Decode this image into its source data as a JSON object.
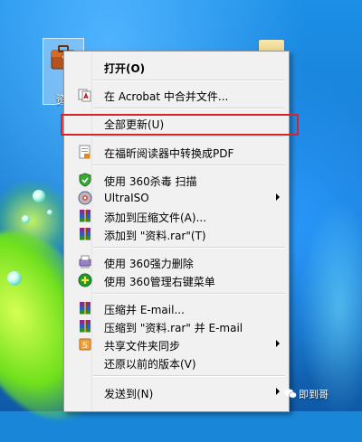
{
  "desktop": {
    "selected_icon_label": "资",
    "watermark_text": "即到哥"
  },
  "context_menu": {
    "items": [
      {
        "label": "打开(O)",
        "bold": true,
        "icon": "none"
      },
      {
        "label": "在 Acrobat 中合并文件...",
        "icon": "acrobat-icon"
      },
      {
        "label": "全部更新(U)",
        "icon": "none",
        "highlighted": true
      },
      {
        "label": "在福昕阅读器中转换成PDF",
        "icon": "foxit-pdf-icon"
      },
      {
        "label": "使用 360杀毒 扫描",
        "icon": "shield-360-icon"
      },
      {
        "label": "UltraISO",
        "icon": "ultraiso-icon",
        "submenu": true
      },
      {
        "label": "添加到压缩文件(A)...",
        "icon": "winrar-icon"
      },
      {
        "label": "添加到 \"资料.rar\"(T)",
        "icon": "winrar-icon"
      },
      {
        "label": "使用 360强力删除",
        "icon": "shredder-icon"
      },
      {
        "label": "使用 360管理右键菜单",
        "icon": "plus-360-icon"
      },
      {
        "label": "压缩并 E-mail...",
        "icon": "winrar-icon"
      },
      {
        "label": "压缩到 \"资料.rar\" 并 E-mail",
        "icon": "winrar-icon"
      },
      {
        "label": "共享文件夹同步",
        "icon": "share-sync-icon",
        "submenu": true
      },
      {
        "label": "还原以前的版本(V)",
        "icon": "none"
      },
      {
        "label": "发送到(N)",
        "icon": "none",
        "submenu": true
      }
    ]
  },
  "colors": {
    "highlight_border": "#d9232b",
    "menu_background": "#f1f1f1",
    "desktop_blue": "#1c8fe6"
  }
}
